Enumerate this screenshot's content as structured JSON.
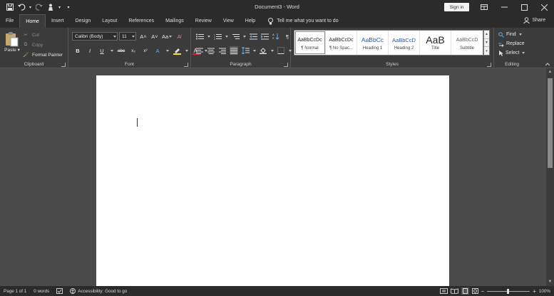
{
  "window": {
    "title": "Document3  -  Word",
    "sign_in_label": "Sign in",
    "share_label": "Share"
  },
  "quick_access": {
    "icons": [
      "save-icon",
      "undo-icon",
      "redo-icon",
      "touch-mode-icon",
      "customize-icon"
    ]
  },
  "tabs": [
    {
      "label": "File",
      "active": false
    },
    {
      "label": "Home",
      "active": true
    },
    {
      "label": "Insert",
      "active": false
    },
    {
      "label": "Design",
      "active": false
    },
    {
      "label": "Layout",
      "active": false
    },
    {
      "label": "References",
      "active": false
    },
    {
      "label": "Mailings",
      "active": false
    },
    {
      "label": "Review",
      "active": false
    },
    {
      "label": "View",
      "active": false
    },
    {
      "label": "Help",
      "active": false
    }
  ],
  "tell_me": "Tell me what you want to do",
  "ribbon": {
    "clipboard": {
      "group_label": "Clipboard",
      "paste": "Paste",
      "cut": "Cut",
      "copy": "Copy",
      "format_painter": "Format Painter"
    },
    "font": {
      "group_label": "Font",
      "font_name": "Calibri (Body)",
      "font_size": "11",
      "bold": "B",
      "italic": "I",
      "underline": "U",
      "strikethrough": "abc",
      "subscript": "x₂",
      "superscript": "x²",
      "grow": "A˄",
      "shrink": "A˅",
      "change_case": "Aa",
      "font_color_hex": "#e02020",
      "highlight_hex": "#ffe600"
    },
    "paragraph": {
      "group_label": "Paragraph",
      "show_marks": "¶"
    },
    "styles": {
      "group_label": "Styles",
      "items": [
        {
          "preview": "AaBbCcDc",
          "name": "¶ Normal",
          "selected": true
        },
        {
          "preview": "AaBbCcDc",
          "name": "¶ No Spac...",
          "selected": false
        },
        {
          "preview": "AaBbCc",
          "name": "Heading 1",
          "selected": false
        },
        {
          "preview": "AaBbCcD",
          "name": "Heading 2",
          "selected": false
        },
        {
          "preview": "AaB",
          "name": "Title",
          "selected": false
        },
        {
          "preview": "AaBbCcD",
          "name": "Subtitle",
          "selected": false
        }
      ]
    },
    "editing": {
      "group_label": "Editing",
      "find": "Find",
      "replace": "Replace",
      "select": "Select"
    }
  },
  "status": {
    "page": "Page 1 of 1",
    "words": "0 words",
    "accessibility": "Accessibility: Good to go",
    "zoom": "100%",
    "zoom_level": 100
  }
}
